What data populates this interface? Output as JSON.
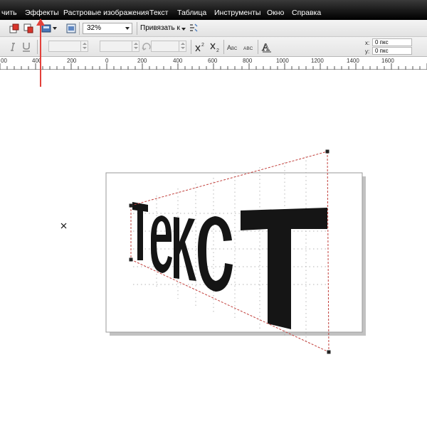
{
  "menu": {
    "items": [
      {
        "label": "чить",
        "key": "print"
      },
      {
        "label": "Эффекты",
        "key": "effects"
      },
      {
        "label": "Растровые изображения",
        "key": "bitmaps"
      },
      {
        "label": "Текст",
        "key": "text"
      },
      {
        "label": "Таблица",
        "key": "table"
      },
      {
        "label": "Инструменты",
        "key": "tools"
      },
      {
        "label": "Окно",
        "key": "window"
      },
      {
        "label": "Справка",
        "key": "help"
      }
    ]
  },
  "toolbar": {
    "zoom_value": "32%",
    "snap_label": "Привязать к"
  },
  "coords": {
    "x_label": "x:",
    "x_value": "0 пкс",
    "y_label": "y:",
    "y_value": "0 пкс"
  },
  "ruler": {
    "labels": [
      "00",
      "400",
      "200",
      "0",
      "200",
      "400",
      "600",
      "800",
      "1000",
      "1200",
      "1400",
      "1600"
    ]
  },
  "canvas": {
    "text": "ТексТ"
  },
  "colors": {
    "menubar": "#1a1a1a",
    "accent_arrow": "#e3403a",
    "envelope_line": "#c2403c"
  }
}
